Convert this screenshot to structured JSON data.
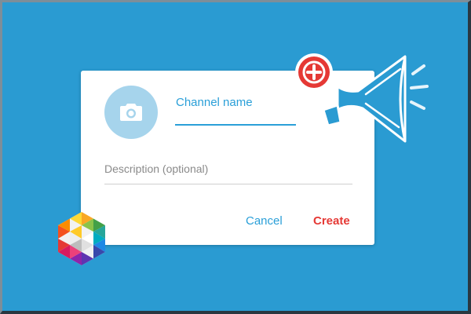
{
  "colors": {
    "background": "#2a9bd2",
    "accent_blue": "#2a9fd8",
    "create_red": "#e53935",
    "avatar_bg": "#a6d4ec"
  },
  "dialog": {
    "avatar_icon": "camera-icon",
    "channel_name_placeholder": "Channel name",
    "description_placeholder": "Description (optional)",
    "cancel_label": "Cancel",
    "create_label": "Create"
  },
  "decorations": {
    "megaphone_icon": "megaphone-icon",
    "badge_icon": "plus-circle-icon",
    "logo_icon": "hexagon-logo-icon"
  }
}
